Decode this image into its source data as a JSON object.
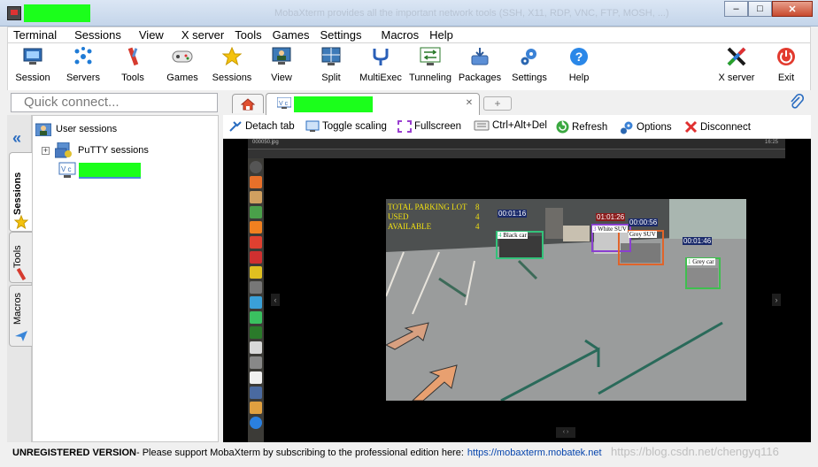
{
  "window": {
    "title_faint": "MobaXterm provides all the important network tools (SSH, X11, RDP, VNC, FTP, MOSH, ...)",
    "buttons": [
      "–",
      "□",
      "✕"
    ]
  },
  "menu": [
    "Terminal",
    "Sessions",
    "View",
    "X server",
    "Tools",
    "Games",
    "Settings",
    "Macros",
    "Help"
  ],
  "toolbar": {
    "items": [
      {
        "label": "Session",
        "icon": "session-icon"
      },
      {
        "label": "Servers",
        "icon": "servers-icon"
      },
      {
        "label": "Tools",
        "icon": "tools-icon"
      },
      {
        "label": "Games",
        "icon": "games-icon"
      },
      {
        "label": "Sessions",
        "icon": "star-icon"
      },
      {
        "label": "View",
        "icon": "view-icon"
      },
      {
        "label": "Split",
        "icon": "split-icon"
      },
      {
        "label": "MultiExec",
        "icon": "multiexec-icon"
      },
      {
        "label": "Tunneling",
        "icon": "tunneling-icon"
      },
      {
        "label": "Packages",
        "icon": "packages-icon"
      },
      {
        "label": "Settings",
        "icon": "settings-icon"
      },
      {
        "label": "Help",
        "icon": "help-icon"
      }
    ],
    "right": [
      {
        "label": "X server",
        "icon": "xserver-icon"
      },
      {
        "label": "Exit",
        "icon": "exit-icon"
      }
    ]
  },
  "quick_connect": {
    "placeholder": "Quick connect..."
  },
  "sidebar": {
    "tabs": [
      "Sessions",
      "Tools",
      "Macros"
    ],
    "tree": {
      "root": "User sessions",
      "group": "PuTTY sessions"
    }
  },
  "session_toolbar": [
    {
      "label": "Detach tab",
      "icon": "detach-icon"
    },
    {
      "label": "Toggle scaling",
      "icon": "scaling-icon"
    },
    {
      "label": "Fullscreen",
      "icon": "fullscreen-icon"
    },
    {
      "label": "Ctrl+Alt+Del",
      "icon": "keyboard-icon"
    },
    {
      "label": "Refresh",
      "icon": "refresh-icon"
    },
    {
      "label": "Options",
      "icon": "options-icon"
    },
    {
      "label": "Disconnect",
      "icon": "disconnect-icon"
    }
  ],
  "remote": {
    "window_title": "000050.jpg",
    "clock": "16:25",
    "overlay": {
      "total": "TOTAL PARKING LOT",
      "total_value": "8",
      "used": "USED",
      "used_value": "4",
      "available": "AVAILABLE",
      "available_value": "4"
    },
    "detections": [
      {
        "id": "4",
        "label": "Black car",
        "timer": "00:01:16",
        "color": "#33c27a"
      },
      {
        "id": "3",
        "label": "White SUV",
        "timer": "01:01:26",
        "color": "#8a3fd0"
      },
      {
        "id": "",
        "label": "Grey SUV",
        "timer": "00:00:56",
        "color": "#e0642a"
      },
      {
        "id": "1",
        "label": "Grey car",
        "timer": "00:01:46",
        "color": "#3fbf4f"
      }
    ]
  },
  "status": {
    "unregistered": "UNREGISTERED VERSION",
    "message": "  -  Please support MobaXterm by subscribing to the professional edition here:",
    "link": "https://mobaxterm.mobatek.net"
  },
  "watermark": "https://blog.csdn.net/chengyq116"
}
